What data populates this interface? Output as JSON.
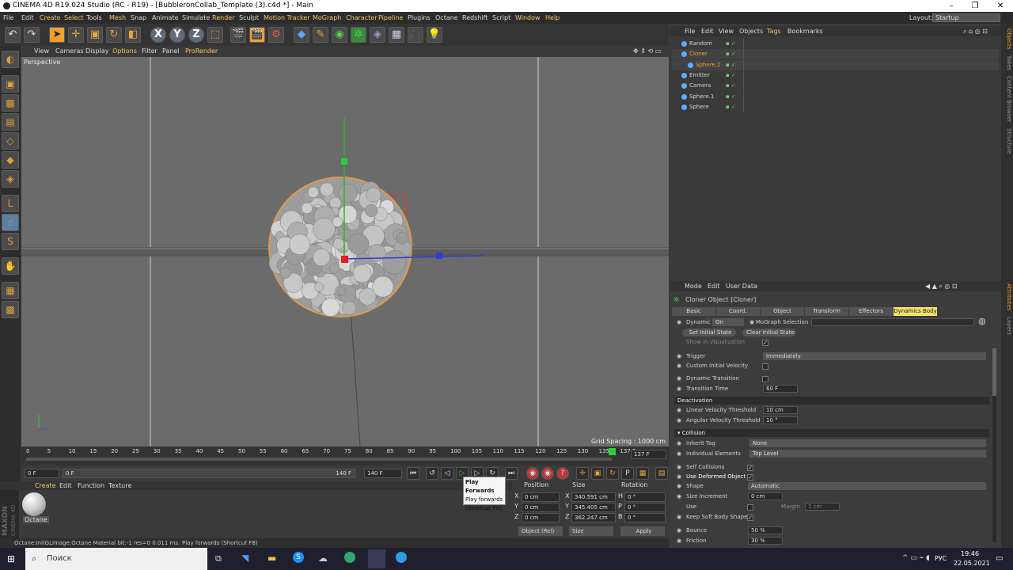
{
  "window": {
    "title": "CINEMA 4D R19.024 Studio (RC - R19) - [BubbleronCollab_Template (3).c4d *] - Main",
    "minimize": "–",
    "maximize": "❐",
    "close": "✕"
  },
  "menubar": {
    "items": [
      "File",
      "Edit",
      "Create",
      "Select",
      "Tools",
      "Mesh",
      "Snap",
      "Animate",
      "Simulate",
      "Render",
      "Sculpt",
      "Motion Tracker",
      "MoGraph",
      "Character",
      "Pipeline",
      "Plugins",
      "Octane",
      "Redshift",
      "Script",
      "Window",
      "Help"
    ],
    "highlighted": [
      "Create",
      "Select",
      "Mesh",
      "Render",
      "Motion Tracker",
      "MoGraph",
      "Character",
      "Pipeline",
      "Window",
      "Help"
    ],
    "layout_label": "Layout:",
    "layout_value": "Startup"
  },
  "toolbar": {
    "undo": "↶",
    "redo": "↷",
    "axis_x": "X",
    "axis_y": "Y",
    "axis_z": "Z"
  },
  "viewport": {
    "menu": [
      "View",
      "Cameras",
      "Display",
      "Options",
      "Filter",
      "Panel",
      "ProRender"
    ],
    "label": "Perspective",
    "grid_spacing": "Grid Spacing : 1000 cm"
  },
  "timeline": {
    "ticks": [
      "0",
      "5",
      "10",
      "15",
      "20",
      "25",
      "30",
      "35",
      "40",
      "45",
      "50",
      "55",
      "60",
      "65",
      "70",
      "75",
      "80",
      "85",
      "90",
      "95",
      "100",
      "105",
      "110",
      "115",
      "120",
      "125",
      "130",
      "135",
      "137 F"
    ],
    "current_frame": "137 F",
    "range_start": "0 F",
    "range_start_inner": "0 F",
    "range_end_inner": "140 F",
    "range_end": "140 F"
  },
  "tooltip": {
    "lines": [
      "Play Forwards",
      "Play forwards",
      "[Shortcut F8]"
    ]
  },
  "material_panel": {
    "menu": [
      "Create",
      "Edit",
      "Function",
      "Texture"
    ],
    "material_name": "Octane",
    "brand_line1": "MAXON",
    "brand_line2": "CINEMA 4D"
  },
  "coords": {
    "headers": [
      "Position",
      "Size",
      "Rotation"
    ],
    "rows": [
      {
        "axis": "X",
        "pos": "0 cm",
        "size_axis": "X",
        "size": "340.591 cm",
        "rot_axis": "H",
        "rot": "0 °"
      },
      {
        "axis": "Y",
        "pos": "0 cm",
        "size_axis": "Y",
        "size": "345.405 cm",
        "rot_axis": "P",
        "rot": "0 °"
      },
      {
        "axis": "Z",
        "pos": "0 cm",
        "size_axis": "Z",
        "size": "362.247 cm",
        "rot_axis": "B",
        "rot": "0 °"
      }
    ],
    "mode_select": "Object (Rel)",
    "size_select": "Size",
    "apply": "Apply"
  },
  "statusbar": {
    "left": "Octane:InitGLImage:Octane Material  bit:-1 res=0  0.011 ms.",
    "right": "Play forwards (Shortcut F8)"
  },
  "object_manager": {
    "menu": [
      "File",
      "Edit",
      "View",
      "Objects",
      "Tags",
      "Bookmarks"
    ],
    "objects": [
      {
        "name": "Random",
        "indent": 0,
        "selected": false
      },
      {
        "name": "Cloner",
        "indent": 0,
        "selected": true
      },
      {
        "name": "Sphere.2",
        "indent": 1,
        "selected": true
      },
      {
        "name": "Emitter",
        "indent": 0,
        "selected": false
      },
      {
        "name": "Camera",
        "indent": 0,
        "selected": false
      },
      {
        "name": "Sphere.1",
        "indent": 0,
        "selected": false
      },
      {
        "name": "Sphere",
        "indent": 0,
        "selected": false
      }
    ],
    "selected_color": "#f0a030"
  },
  "attributes": {
    "menu": [
      "Mode",
      "Edit",
      "User Data"
    ],
    "object_title": "Cloner Object [Cloner]",
    "tabs": [
      "Basic",
      "Coord.",
      "Object",
      "Transform",
      "Effectors",
      "Dynamics Body"
    ],
    "active_tab": "Dynamics Body",
    "dynamic_label": "Dynamic",
    "dynamic_value": "On",
    "mograph_selection": "MoGraph Selection",
    "set_initial_state": "Set Initial State",
    "clear_initial_state": "Clear Initial State",
    "show_in_visualization": "Show in Visualization",
    "trigger_label": "Trigger",
    "trigger_value": "Immediately",
    "custom_initial_velocity": "Custom Initial Velocity",
    "dynamic_transition": "Dynamic Transition",
    "transition_time_label": "Transition Time",
    "transition_time_value": "60 F",
    "deactivation_section": "Deactivation",
    "linear_velocity_label": "Linear Velocity Threshold",
    "linear_velocity_value": "10 cm",
    "angular_velocity_label": "Angular Velocity Threshold",
    "angular_velocity_value": "10 °",
    "collision_section": "Collision",
    "inherit_tag_label": "Inherit Tag",
    "inherit_tag_value": "None",
    "individual_elements_label": "Individual Elements",
    "individual_elements_value": "Top Level",
    "self_collisions": "Self Collisions",
    "use_deformed_object": "Use Deformed Object",
    "shape_label": "Shape",
    "shape_value": "Automatic",
    "size_increment_label": "Size Increment",
    "size_increment_value": "0 cm",
    "use_label": "Use",
    "margin_label": "Margin",
    "margin_value": "1 cm",
    "keep_soft_body_shape": "Keep Soft Body Shape",
    "bounce_label": "Bounce",
    "bounce_value": "50 %",
    "friction_label": "Friction",
    "friction_value": "30 %"
  },
  "side_tabs": [
    "Objects",
    "Takes",
    "Content Browser",
    "Structure",
    "Attributes",
    "Layers"
  ],
  "taskbar": {
    "search": "Поиск",
    "lang": "РУС",
    "time": "19:46",
    "date": "22.05.2021"
  }
}
